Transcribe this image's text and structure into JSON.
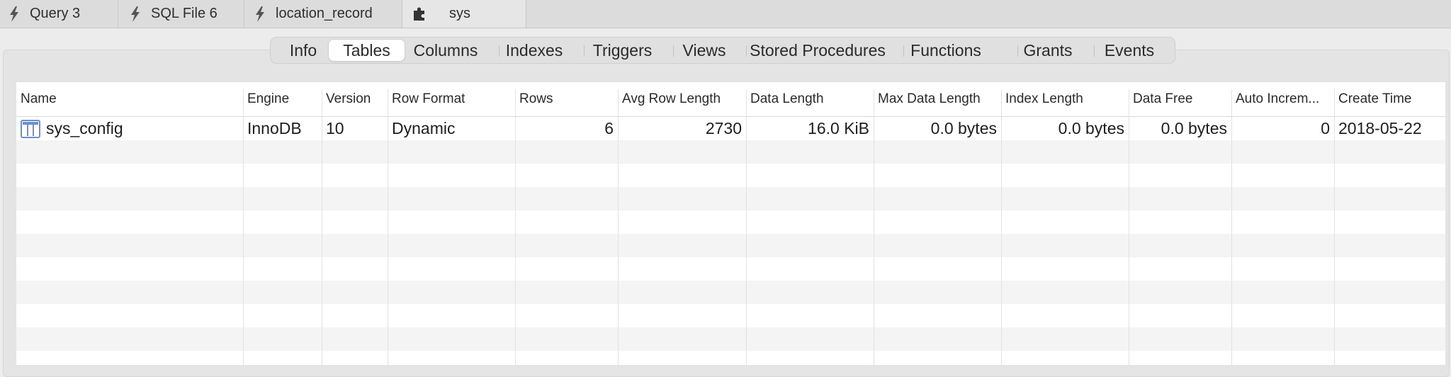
{
  "tabs": [
    {
      "label": "Query 3",
      "icon": "lightning-icon"
    },
    {
      "label": "SQL File 6",
      "icon": "lightning-icon"
    },
    {
      "label": "location_record",
      "icon": "lightning-icon"
    },
    {
      "label": "sys",
      "icon": "puzzle-icon"
    }
  ],
  "segments": [
    "Info",
    "Tables",
    "Columns",
    "Indexes",
    "Triggers",
    "Views",
    "Stored Procedures",
    "Functions",
    "Grants",
    "Events"
  ],
  "active_segment": "Tables",
  "columns": [
    "Name",
    "Engine",
    "Version",
    "Row Format",
    "Rows",
    "Avg Row Length",
    "Data Length",
    "Max Data Length",
    "Index Length",
    "Data Free",
    "Auto Increm...",
    "Create Time"
  ],
  "rows": [
    {
      "name": "sys_config",
      "engine": "InnoDB",
      "version": "10",
      "row_format": "Dynamic",
      "rows": "6",
      "avg_row_length": "2730",
      "data_length": "16.0 KiB",
      "max_data_length": "0.0 bytes",
      "index_length": "0.0 bytes",
      "data_free": "0.0 bytes",
      "auto_increment": "0",
      "create_time": "2018-05-22"
    }
  ],
  "colors": {
    "accent_icon": "#6b8fd6",
    "row_alt": "#f3f4f3",
    "tab_bg": "#dcdcdc"
  }
}
